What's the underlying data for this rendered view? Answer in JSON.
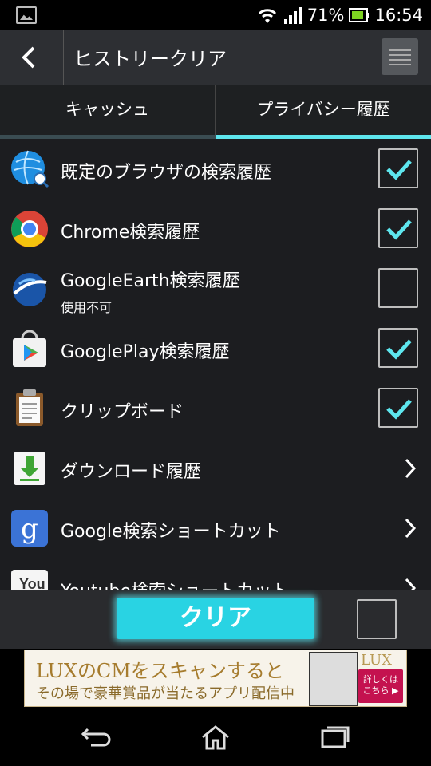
{
  "status_bar": {
    "battery_percent": "71%",
    "time": "16:54",
    "icons": [
      "image-icon",
      "wifi-icon",
      "signal-icon",
      "battery-icon"
    ]
  },
  "header": {
    "title": "ヒストリークリア",
    "icons": [
      "back-arrow-icon",
      "menu-icon"
    ]
  },
  "tabs": [
    {
      "label": "キャッシュ",
      "selected": false
    },
    {
      "label": "プライバシー履歴",
      "selected": true
    }
  ],
  "colors": {
    "accent": "#5ee6ee",
    "button": "#29d3e3",
    "background": "#1c1d20"
  },
  "items": [
    {
      "label": "既定のブラウザの検索履歴",
      "icon": "browser-globe-icon",
      "control": "checkbox",
      "checked": true
    },
    {
      "label": "Chrome検索履歴",
      "icon": "chrome-icon",
      "control": "checkbox",
      "checked": true
    },
    {
      "label": "GoogleEarth検索履歴",
      "sublabel": "使用不可",
      "icon": "google-earth-icon",
      "control": "checkbox",
      "checked": false
    },
    {
      "label": "GooglePlay検索履歴",
      "icon": "google-play-icon",
      "control": "checkbox",
      "checked": true
    },
    {
      "label": "クリップボード",
      "icon": "clipboard-icon",
      "control": "checkbox",
      "checked": true
    },
    {
      "label": "ダウンロード履歴",
      "icon": "download-icon",
      "control": "chevron"
    },
    {
      "label": "Google検索ショートカット",
      "icon": "google-search-icon",
      "control": "chevron"
    },
    {
      "label": "Youtube検索ショートカット",
      "icon": "youtube-icon",
      "control": "chevron"
    }
  ],
  "bottom_bar": {
    "clear_label": "クリア",
    "select_all_checked": false
  },
  "ad": {
    "line1": "LUXのCMをスキャンすると",
    "line2": "その場で豪華賞品が当たるアプリ配信中",
    "logo": "LUX",
    "badge": "詳しくは こちら ▶"
  },
  "nav_bar": {
    "icons": [
      "back-icon",
      "home-icon",
      "recent-apps-icon"
    ]
  }
}
